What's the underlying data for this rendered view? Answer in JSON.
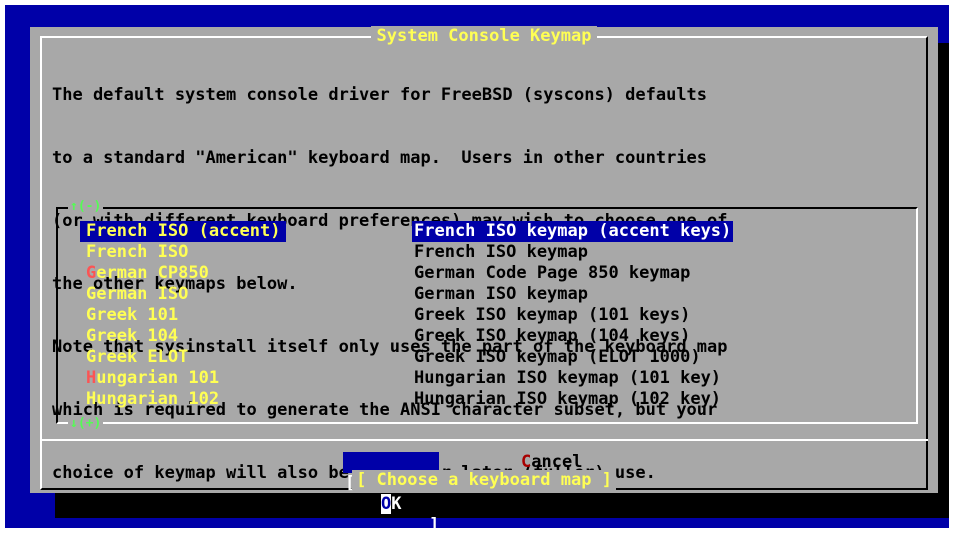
{
  "window": {
    "title": "System Console Keymap",
    "footer": "[ Choose a keyboard map ]"
  },
  "description": [
    "The default system console driver for FreeBSD (syscons) defaults",
    "to a standard \"American\" keyboard map.  Users in other countries",
    "(or with different keyboard preferences) may wish to choose one of",
    "the other keymaps below.",
    "Note that sysinstall itself only uses the part of the keyboard map",
    "which is required to generate the ANSI character subset, but your",
    "choice of keymap will also be saved for later (fuller) use."
  ],
  "list": {
    "scroll_up": "↑(-)",
    "scroll_down": "↓(+)",
    "items": [
      {
        "hot": "",
        "rest": "French ISO (accent)",
        "desc": "French ISO keymap (accent keys)",
        "selected": true
      },
      {
        "hot": "",
        "rest": "French ISO",
        "desc": "French ISO keymap",
        "selected": false
      },
      {
        "hot": "G",
        "rest": "erman CP850",
        "desc": "German Code Page 850 keymap",
        "selected": false
      },
      {
        "hot": "",
        "rest": "German ISO",
        "desc": "German ISO keymap",
        "selected": false
      },
      {
        "hot": "",
        "rest": "Greek 101",
        "desc": "Greek ISO keymap (101 keys)",
        "selected": false
      },
      {
        "hot": "",
        "rest": "Greek 104",
        "desc": "Greek ISO keymap (104 keys)",
        "selected": false
      },
      {
        "hot": "",
        "rest": "Greek ELOT",
        "desc": "Greek ISO keymap (ELOT 1000)",
        "selected": false
      },
      {
        "hot": "H",
        "rest": "ungarian 101",
        "desc": "Hungarian ISO keymap (101 key)",
        "selected": false
      },
      {
        "hot": "",
        "rest": "Hungarian 102",
        "desc": "Hungarian ISO keymap (102 key)",
        "selected": false
      }
    ]
  },
  "buttons": {
    "ok": {
      "left_bracket": "[",
      "hot": "O",
      "rest": "K",
      "right_bracket": "]"
    },
    "cancel": {
      "hot": "C",
      "rest": "ancel"
    }
  },
  "colors": {
    "background": "#0000a8",
    "dialog": "#a8a8a8",
    "highlight": "#ffff54",
    "hotkey": "#fc5454",
    "scroll_indicator": "#54fc54"
  }
}
